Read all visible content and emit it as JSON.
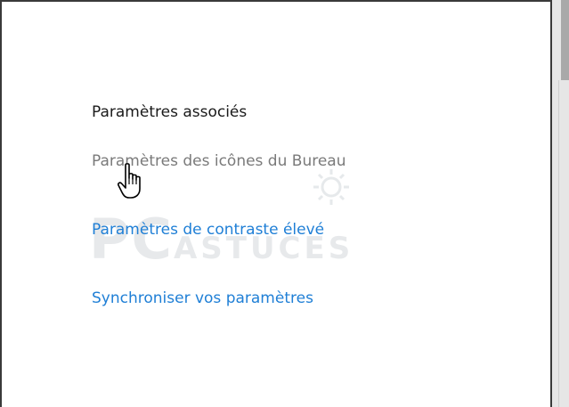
{
  "related_settings": {
    "title": "Paramètres associés",
    "links": [
      {
        "label": "Paramètres des icônes du Bureau",
        "state": "hover"
      },
      {
        "label": "Paramètres de contraste élevé",
        "state": "normal"
      },
      {
        "label": "Synchroniser vos paramètres",
        "state": "normal"
      }
    ]
  },
  "watermark": {
    "text_big": "PC",
    "text_small": "ASTUCES"
  },
  "colors": {
    "link": "#1f7fd6",
    "link_hover": "#7a7a7a",
    "title": "#1a1a1a",
    "background": "#ffffff"
  },
  "cursor": {
    "icon": "hand-pointer-icon"
  }
}
